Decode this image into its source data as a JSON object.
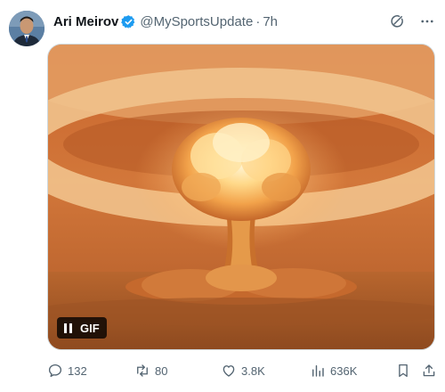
{
  "author": {
    "name": "Ari Meirov",
    "handle": "@MySportsUpdate",
    "separator": "·",
    "time": "7h",
    "verified": true,
    "verified_color": "#1d9bf0"
  },
  "media": {
    "badge_label": "GIF",
    "state": "paused",
    "subject": "mushroom cloud explosion"
  },
  "actions": {
    "replies": "132",
    "reposts": "80",
    "likes": "3.8K",
    "views": "636K"
  },
  "icons": [
    "grok-icon",
    "more-icon",
    "reply-icon",
    "repost-icon",
    "like-icon",
    "views-icon",
    "bookmark-icon",
    "share-icon",
    "pause-icon",
    "verified-icon"
  ]
}
